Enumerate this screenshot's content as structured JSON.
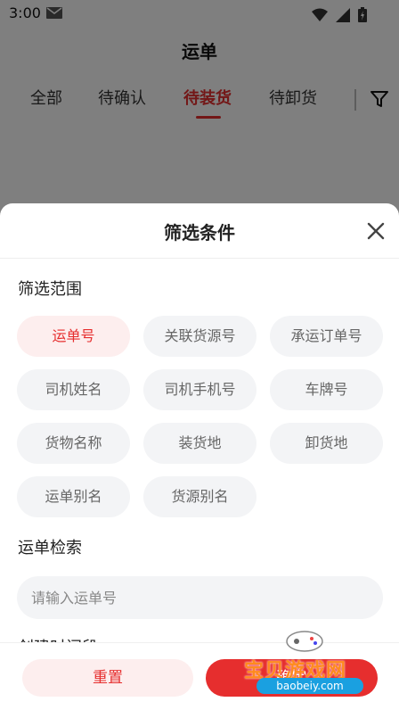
{
  "status_bar": {
    "time": "3:00"
  },
  "nav": {
    "title": "运单",
    "tabs": [
      {
        "label": "全部"
      },
      {
        "label": "待确认"
      },
      {
        "label": "待装货"
      },
      {
        "label": "待卸货"
      }
    ],
    "active_tab": 2
  },
  "sheet": {
    "title": "筛选条件",
    "scope_label": "筛选范围",
    "chips": [
      {
        "label": "运单号",
        "selected": true
      },
      {
        "label": "关联货源号",
        "selected": false
      },
      {
        "label": "承运订单号",
        "selected": false
      },
      {
        "label": "司机姓名",
        "selected": false
      },
      {
        "label": "司机手机号",
        "selected": false
      },
      {
        "label": "车牌号",
        "selected": false
      },
      {
        "label": "货物名称",
        "selected": false
      },
      {
        "label": "装货地",
        "selected": false
      },
      {
        "label": "卸货地",
        "selected": false
      },
      {
        "label": "运单别名",
        "selected": false
      },
      {
        "label": "货源别名",
        "selected": false
      }
    ],
    "search_label": "运单检索",
    "search_placeholder": "请输入运单号",
    "search_value": "",
    "created_label": "创建时间段"
  },
  "footer": {
    "reset_label": "重置",
    "confirm_label": "确定"
  },
  "watermark": {
    "text": "宝贝游戏网",
    "url": "baobeiy.com"
  },
  "colors": {
    "accent": "#e62e2e",
    "accent_soft": "#fdeeee",
    "chip_bg": "#f3f4f6"
  }
}
